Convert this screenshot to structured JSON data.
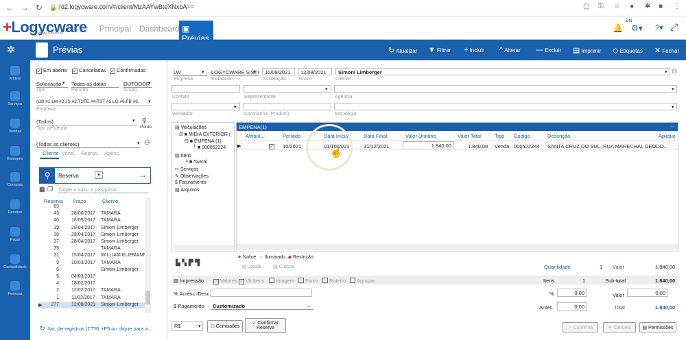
{
  "browser": {
    "url": "rd2.logycware.com/#/client/MzAAYwBteXNxbA=="
  },
  "app": {
    "logo": "Logycware",
    "logo_sub": "Credibility Solutions",
    "tabs": [
      "Principal",
      "Dashboards",
      "Prévias"
    ],
    "lang": "EN"
  },
  "toolbar": {
    "title": "Prévias",
    "actions": [
      "Atualizar",
      "Filtrar",
      "Incluir",
      "Alterar",
      "Excluir",
      "Imprimir",
      "Etiquetas",
      "Fechar"
    ]
  },
  "sidenav": [
    "Mídias",
    "Serviços",
    "Vendas",
    "Estoques",
    "Compras",
    "Receber",
    "Pagar",
    "Contabilidade",
    "Pessoas"
  ],
  "filters": {
    "chk_em_aberto": "Em aberto",
    "chk_canceladas": "Canceladas",
    "chk_confirmadas": "Confirmadas",
    "tipo_val": "Solicitação",
    "tipo_lbl": "Tipo",
    "periodo_val": "Todas as datas",
    "periodo_lbl": "Período",
    "grupo_val": "OUTDOOR",
    "grupo_lbl": "Grupo",
    "empresa_val": "(LW #1,LM #2,JS #3,TSTE #4,TST #5,LG #6,FB #8,",
    "empresa_lbl": "Empresa",
    "tipovenda_val": "(Todos)",
    "tipovenda_lbl": "Tipo de Venda",
    "ponto": "Ponto",
    "clientes_val": "(Todos os clientes)",
    "ctabs": [
      "Cliente",
      "Vend.",
      "Repres.",
      "Agênc."
    ]
  },
  "search": {
    "field": "Reserva",
    "placeholder": "Digite o valor a pesquisar"
  },
  "list": {
    "headers": [
      "Reserva",
      "Prazo",
      "Cliente"
    ],
    "rows": [
      [
        "69",
        "",
        ""
      ],
      [
        "43",
        "28/06/2017",
        "TAMARA"
      ],
      [
        "40",
        "18/05/2017",
        "TAMARA"
      ],
      [
        "39",
        "28/04/2017",
        "Simoni Limberger"
      ],
      [
        "38",
        "28/04/2017",
        "Simoni Limberger"
      ],
      [
        "37",
        "28/04/2017",
        "Simoni Limberger"
      ],
      [
        "35",
        "",
        "TAMARA"
      ],
      [
        "31",
        "15/04/2017",
        "WILLIAM KLIEMANN"
      ],
      [
        "9",
        "10/03/2017",
        "TAMARA"
      ],
      [
        "6",
        "",
        "Simoni Limberger"
      ],
      [
        "5",
        "04/03/2017",
        ""
      ],
      [
        "4",
        "18/02/2017",
        ""
      ],
      [
        "2",
        "12/02/2017",
        "TAMARA"
      ],
      [
        "1",
        "11/02/2017",
        "TAMARA"
      ],
      [
        "277",
        "12/08/2021",
        "Simoni Limberger"
      ]
    ],
    "footer": "No. de registros (CTRL+F5 ou clique para a..."
  },
  "header": {
    "empresa": "LW",
    "empresa_lbl": "Empresa",
    "exibidora": "LOGYCWARE SISTI",
    "exibidora_lbl": "Exibidora",
    "solicitacao": "10/08/2021",
    "solicitacao_lbl": "Solicitação",
    "prazo": "12/08/2021",
    "prazo_lbl": "Prazo",
    "cliente": "Simoni Limberger",
    "cliente_lbl": "Cliente",
    "contato_lbl": "Contato",
    "representante_lbl": "Representante",
    "agencia_lbl": "Agência",
    "vendedor_lbl": "Vendedor",
    "campanha_lbl": "Campanha (Produto)",
    "estrategia_lbl": "Estratégia"
  },
  "tree": {
    "items": [
      "Veiculações",
      "MIDIA EXTERIOR (",
      "EMPENA (1)",
      "000052224",
      "Itens",
      "*Geral",
      "Serviços",
      "Observações",
      "Faturamento",
      "Arquivos"
    ]
  },
  "grid": {
    "title": "EMPENA(1)",
    "headers": [
      "Atribut...",
      "Período",
      "Data Inicial",
      "Data Final",
      "Valor Unitário",
      "Valor Total",
      "Tipo",
      "Código",
      "Descrição",
      "Aplique"
    ],
    "row": [
      "10/2021",
      "01/10/2021",
      "31/12/2021",
      "1.840,00",
      "1.840,00",
      "Venda",
      "000522244",
      "SANTA CRUZ DO SUL, RUA MARECHAL DEODO..."
    ],
    "legend": [
      "Nobre",
      "Iluminado",
      "Restrição"
    ],
    "footer_btns": [
      "Locais",
      "Custos"
    ],
    "quantidade_lbl": "Quantidade",
    "quantidade": "1",
    "valor_lbl": "Valor",
    "valor": "1.840,00"
  },
  "bottom": {
    "impressao": "Impressão",
    "opts": [
      "Valores",
      "Vlr.Itens",
      "Imagem",
      "Fluxo",
      "Roteiro",
      "Agrupar"
    ],
    "acresc": "Acrésc./Desc.",
    "pagamento": "Pagamento",
    "pagamento_val": "Customizado",
    "itens_lbl": "Itens",
    "itens": "1",
    "subtotal_lbl": "Sub-total",
    "subtotal": "1.840,00",
    "pct": "%",
    "pct_val": "0,00",
    "valor_lbl": "Valor",
    "valor_val": "0,00",
    "antec_lbl": "Antec.",
    "antec_val": "0,00",
    "total_lbl": "Total",
    "total": "1.840,00",
    "moeda": "R$",
    "comissoes": "Comissões",
    "confirmar": "Confirmar Reserva",
    "confirma": "Confirma",
    "cancela": "Cancela",
    "permissoes": "Permissões"
  }
}
